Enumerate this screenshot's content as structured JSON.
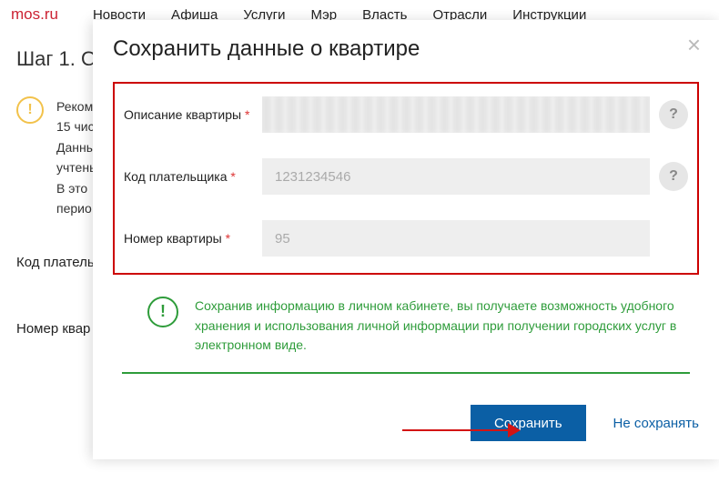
{
  "header": {
    "logo": "mos.ru",
    "nav": [
      "Новости",
      "Афиша",
      "Услуги",
      "Мэр",
      "Власть",
      "Отрасли",
      "Инструкции"
    ]
  },
  "background": {
    "step_title": "Шаг 1. О",
    "notice_lines": [
      "Реком",
      "15 чис",
      "Данны",
      "учтены",
      "В это",
      "перио"
    ],
    "label_code": "Код плательщ",
    "label_apt": "Номер квар"
  },
  "modal": {
    "title": "Сохранить данные о квартире",
    "fields": {
      "description": {
        "label": "Описание квартиры",
        "value": ""
      },
      "payer_code": {
        "label": "Код плательщика",
        "value": "1231234546"
      },
      "apt_number": {
        "label": "Номер квартиры",
        "value": "95"
      }
    },
    "required_mark": "*",
    "help_glyph": "?",
    "info_icon_glyph": "!",
    "info_text": "Сохранив информацию в личном кабинете, вы получаете возможность удобного хранения и использования личной информации при получении городских услуг в электронном виде.",
    "buttons": {
      "save": "Сохранить",
      "dont_save": "Не сохранять"
    }
  }
}
